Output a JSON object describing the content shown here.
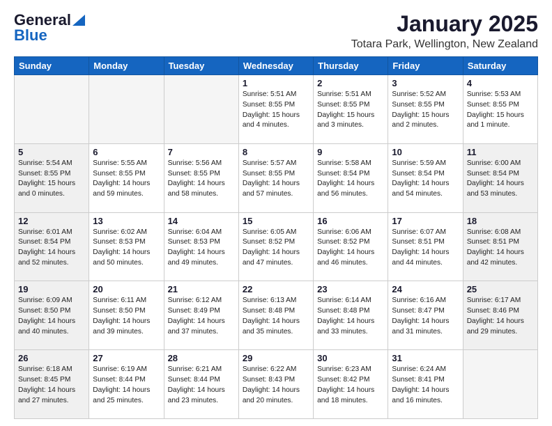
{
  "header": {
    "logo_general": "General",
    "logo_blue": "Blue",
    "month_title": "January 2025",
    "location": "Totara Park, Wellington, New Zealand"
  },
  "weekdays": [
    "Sunday",
    "Monday",
    "Tuesday",
    "Wednesday",
    "Thursday",
    "Friday",
    "Saturday"
  ],
  "weeks": [
    [
      {
        "day": "",
        "text": "",
        "shaded": true
      },
      {
        "day": "",
        "text": "",
        "shaded": true
      },
      {
        "day": "",
        "text": "",
        "shaded": true
      },
      {
        "day": "1",
        "text": "Sunrise: 5:51 AM\nSunset: 8:55 PM\nDaylight: 15 hours\nand 4 minutes.",
        "shaded": false
      },
      {
        "day": "2",
        "text": "Sunrise: 5:51 AM\nSunset: 8:55 PM\nDaylight: 15 hours\nand 3 minutes.",
        "shaded": false
      },
      {
        "day": "3",
        "text": "Sunrise: 5:52 AM\nSunset: 8:55 PM\nDaylight: 15 hours\nand 2 minutes.",
        "shaded": false
      },
      {
        "day": "4",
        "text": "Sunrise: 5:53 AM\nSunset: 8:55 PM\nDaylight: 15 hours\nand 1 minute.",
        "shaded": false
      }
    ],
    [
      {
        "day": "5",
        "text": "Sunrise: 5:54 AM\nSunset: 8:55 PM\nDaylight: 15 hours\nand 0 minutes.",
        "shaded": true
      },
      {
        "day": "6",
        "text": "Sunrise: 5:55 AM\nSunset: 8:55 PM\nDaylight: 14 hours\nand 59 minutes.",
        "shaded": false
      },
      {
        "day": "7",
        "text": "Sunrise: 5:56 AM\nSunset: 8:55 PM\nDaylight: 14 hours\nand 58 minutes.",
        "shaded": false
      },
      {
        "day": "8",
        "text": "Sunrise: 5:57 AM\nSunset: 8:55 PM\nDaylight: 14 hours\nand 57 minutes.",
        "shaded": false
      },
      {
        "day": "9",
        "text": "Sunrise: 5:58 AM\nSunset: 8:54 PM\nDaylight: 14 hours\nand 56 minutes.",
        "shaded": false
      },
      {
        "day": "10",
        "text": "Sunrise: 5:59 AM\nSunset: 8:54 PM\nDaylight: 14 hours\nand 54 minutes.",
        "shaded": false
      },
      {
        "day": "11",
        "text": "Sunrise: 6:00 AM\nSunset: 8:54 PM\nDaylight: 14 hours\nand 53 minutes.",
        "shaded": true
      }
    ],
    [
      {
        "day": "12",
        "text": "Sunrise: 6:01 AM\nSunset: 8:54 PM\nDaylight: 14 hours\nand 52 minutes.",
        "shaded": true
      },
      {
        "day": "13",
        "text": "Sunrise: 6:02 AM\nSunset: 8:53 PM\nDaylight: 14 hours\nand 50 minutes.",
        "shaded": false
      },
      {
        "day": "14",
        "text": "Sunrise: 6:04 AM\nSunset: 8:53 PM\nDaylight: 14 hours\nand 49 minutes.",
        "shaded": false
      },
      {
        "day": "15",
        "text": "Sunrise: 6:05 AM\nSunset: 8:52 PM\nDaylight: 14 hours\nand 47 minutes.",
        "shaded": false
      },
      {
        "day": "16",
        "text": "Sunrise: 6:06 AM\nSunset: 8:52 PM\nDaylight: 14 hours\nand 46 minutes.",
        "shaded": false
      },
      {
        "day": "17",
        "text": "Sunrise: 6:07 AM\nSunset: 8:51 PM\nDaylight: 14 hours\nand 44 minutes.",
        "shaded": false
      },
      {
        "day": "18",
        "text": "Sunrise: 6:08 AM\nSunset: 8:51 PM\nDaylight: 14 hours\nand 42 minutes.",
        "shaded": true
      }
    ],
    [
      {
        "day": "19",
        "text": "Sunrise: 6:09 AM\nSunset: 8:50 PM\nDaylight: 14 hours\nand 40 minutes.",
        "shaded": true
      },
      {
        "day": "20",
        "text": "Sunrise: 6:11 AM\nSunset: 8:50 PM\nDaylight: 14 hours\nand 39 minutes.",
        "shaded": false
      },
      {
        "day": "21",
        "text": "Sunrise: 6:12 AM\nSunset: 8:49 PM\nDaylight: 14 hours\nand 37 minutes.",
        "shaded": false
      },
      {
        "day": "22",
        "text": "Sunrise: 6:13 AM\nSunset: 8:48 PM\nDaylight: 14 hours\nand 35 minutes.",
        "shaded": false
      },
      {
        "day": "23",
        "text": "Sunrise: 6:14 AM\nSunset: 8:48 PM\nDaylight: 14 hours\nand 33 minutes.",
        "shaded": false
      },
      {
        "day": "24",
        "text": "Sunrise: 6:16 AM\nSunset: 8:47 PM\nDaylight: 14 hours\nand 31 minutes.",
        "shaded": false
      },
      {
        "day": "25",
        "text": "Sunrise: 6:17 AM\nSunset: 8:46 PM\nDaylight: 14 hours\nand 29 minutes.",
        "shaded": true
      }
    ],
    [
      {
        "day": "26",
        "text": "Sunrise: 6:18 AM\nSunset: 8:45 PM\nDaylight: 14 hours\nand 27 minutes.",
        "shaded": true
      },
      {
        "day": "27",
        "text": "Sunrise: 6:19 AM\nSunset: 8:44 PM\nDaylight: 14 hours\nand 25 minutes.",
        "shaded": false
      },
      {
        "day": "28",
        "text": "Sunrise: 6:21 AM\nSunset: 8:44 PM\nDaylight: 14 hours\nand 23 minutes.",
        "shaded": false
      },
      {
        "day": "29",
        "text": "Sunrise: 6:22 AM\nSunset: 8:43 PM\nDaylight: 14 hours\nand 20 minutes.",
        "shaded": false
      },
      {
        "day": "30",
        "text": "Sunrise: 6:23 AM\nSunset: 8:42 PM\nDaylight: 14 hours\nand 18 minutes.",
        "shaded": false
      },
      {
        "day": "31",
        "text": "Sunrise: 6:24 AM\nSunset: 8:41 PM\nDaylight: 14 hours\nand 16 minutes.",
        "shaded": false
      },
      {
        "day": "",
        "text": "",
        "shaded": true
      }
    ]
  ]
}
